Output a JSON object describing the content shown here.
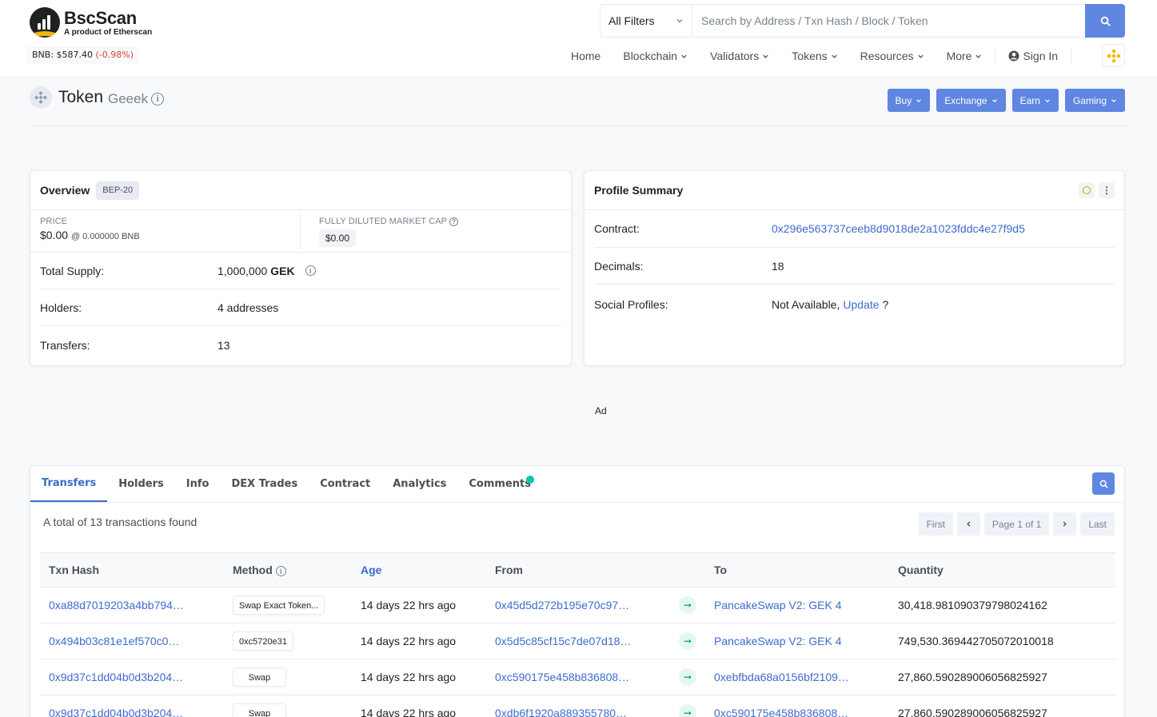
{
  "header": {
    "logo_title": "BscScan",
    "logo_sub": "A product of Etherscan",
    "price_label": "BNB:",
    "price_value": "$587.40",
    "price_change": "(-0.98%)",
    "filter_label": "All Filters",
    "search_placeholder": "Search by Address / Txn Hash / Block / Token",
    "nav": [
      "Home",
      "Blockchain",
      "Validators",
      "Tokens",
      "Resources",
      "More"
    ],
    "sign_in": "Sign In"
  },
  "title": {
    "label": "Token",
    "name": "Geeek",
    "actions": [
      "Buy",
      "Exchange",
      "Earn",
      "Gaming"
    ]
  },
  "overview": {
    "title": "Overview",
    "badge": "BEP-20",
    "price_label": "PRICE",
    "price_value": "$0.00",
    "price_bnb": "@ 0.000000 BNB",
    "mcap_label": "FULLY DILUTED MARKET CAP",
    "mcap_value": "$0.00",
    "supply_label": "Total Supply:",
    "supply_value": "1,000,000",
    "supply_symbol": "GEK",
    "holders_label": "Holders:",
    "holders_value": "4 addresses",
    "transfers_label": "Transfers:",
    "transfers_value": "13"
  },
  "profile": {
    "title": "Profile Summary",
    "contract_label": "Contract:",
    "contract_value": "0x296e563737ceeb8d9018de2a1023fddc4e27f9d5",
    "decimals_label": "Decimals:",
    "decimals_value": "18",
    "social_label": "Social Profiles:",
    "social_value": "Not Available,",
    "social_link": "Update",
    "social_q": "?"
  },
  "ad_label": "Ad",
  "transfers": {
    "tabs": [
      "Transfers",
      "Holders",
      "Info",
      "DEX Trades",
      "Contract",
      "Analytics",
      "Comments"
    ],
    "total_text": "A total of 13 transactions found",
    "pager": {
      "first": "First",
      "page": "Page 1 of 1",
      "last": "Last"
    },
    "columns": [
      "Txn Hash",
      "Method",
      "Age",
      "From",
      "To",
      "Quantity"
    ],
    "rows": [
      {
        "hash": "0xa88d7019203a4bb794…",
        "method": "Swap Exact Token...",
        "age": "14 days 22 hrs ago",
        "from": "0x45d5d272b195e70c97…",
        "to": "PancakeSwap V2: GEK 4",
        "qty": "30,418.981090379798024162"
      },
      {
        "hash": "0x494b03c81e1ef570c0…",
        "method": "0xc5720e31",
        "age": "14 days 22 hrs ago",
        "from": "0x5d5c85cf15c7de07d18…",
        "to": "PancakeSwap V2: GEK 4",
        "qty": "749,530.369442705072010018"
      },
      {
        "hash": "0x9d37c1dd04b0d3b204…",
        "method": "Swap",
        "age": "14 days 22 hrs ago",
        "from": "0xc590175e458b836808…",
        "to": "0xebfbda68a0156bf2109…",
        "qty": "27,860.590289006056825927"
      },
      {
        "hash": "0x9d37c1dd04b0d3b204…",
        "method": "Swap",
        "age": "14 days 22 hrs ago",
        "from": "0xdb6f1920a889355780…",
        "to": "0xc590175e458b836808…",
        "qty": "27,860.590289006056825927"
      }
    ]
  },
  "colors": {
    "accent": "#5f86e0",
    "link": "#3e6bcc",
    "negative": "#de4437",
    "bnb": "#f0b90b",
    "success": "#00c9a7"
  }
}
